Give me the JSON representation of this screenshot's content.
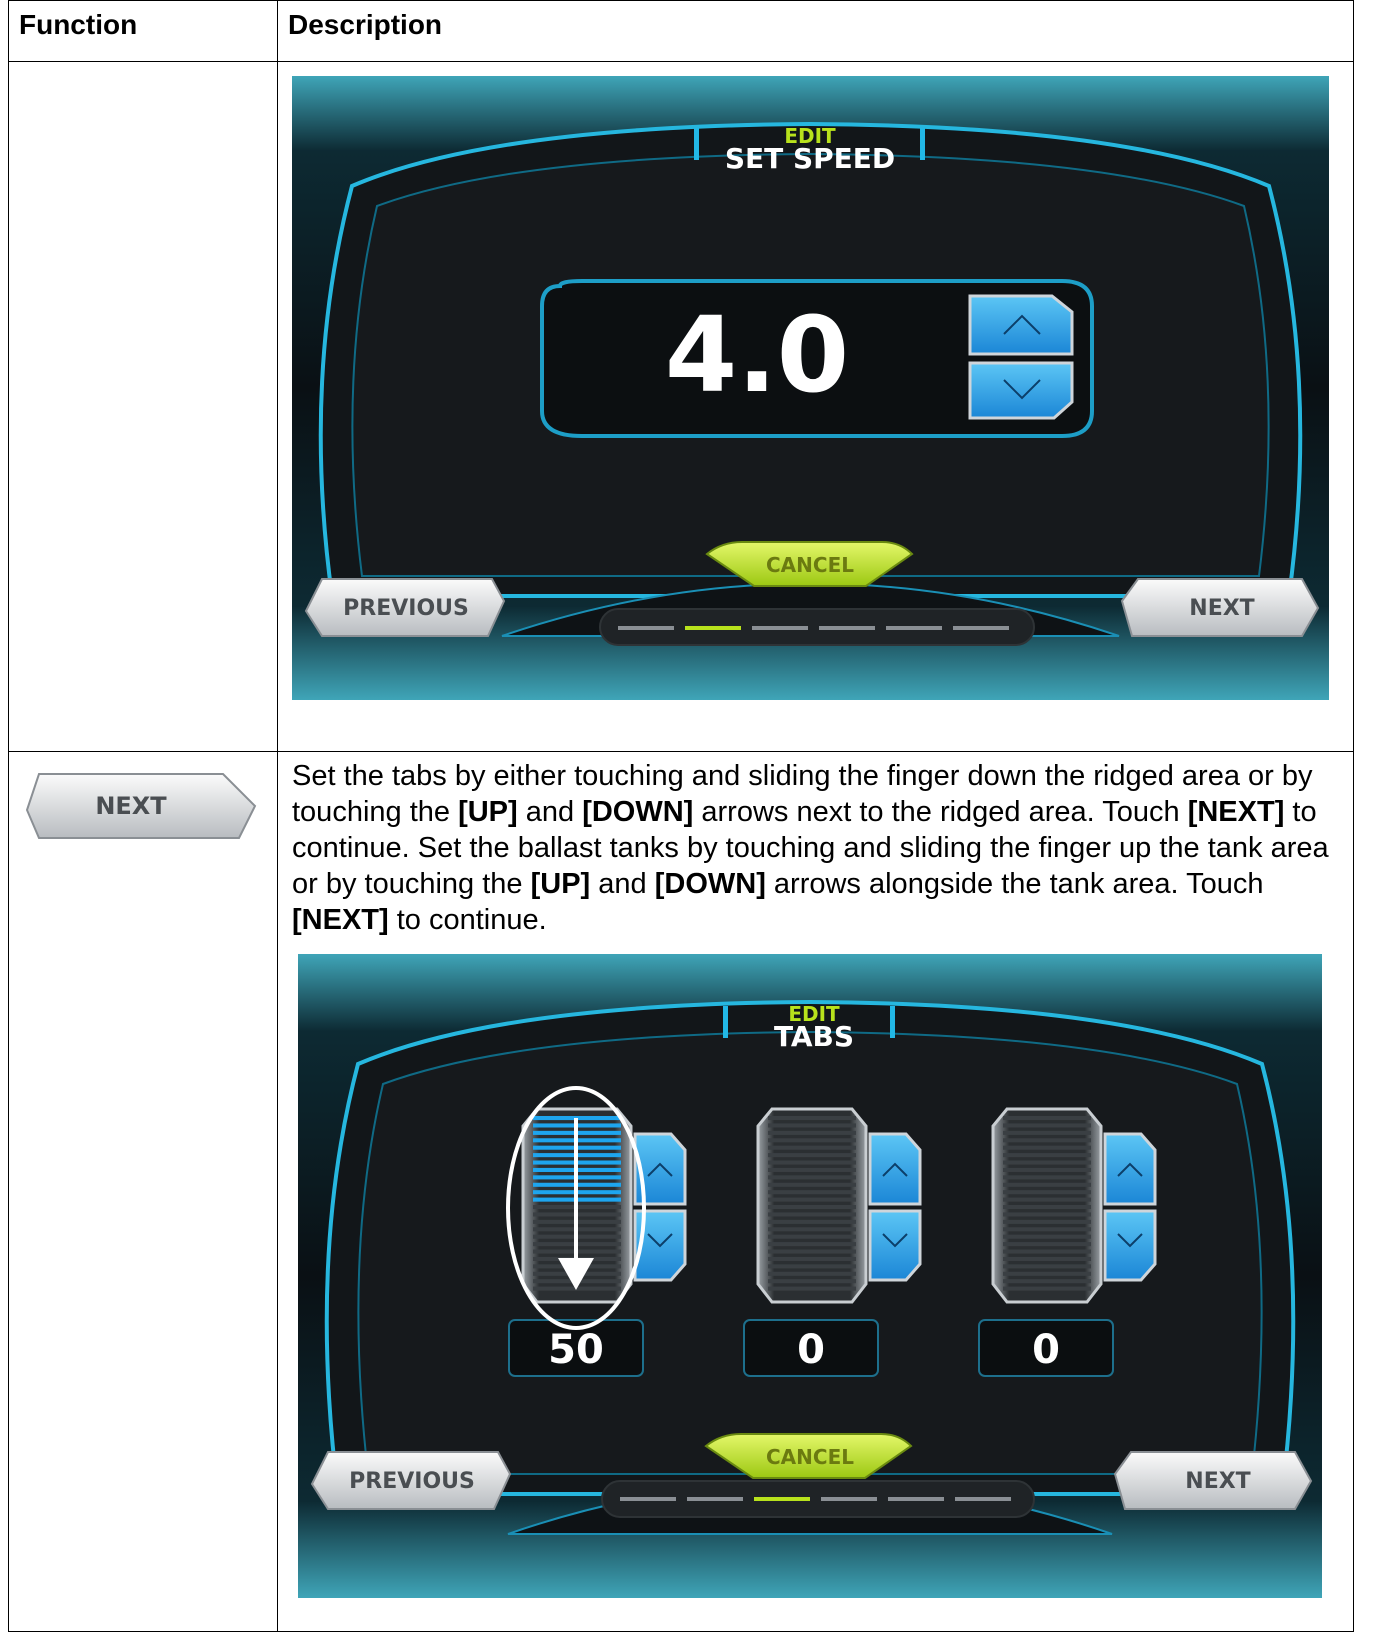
{
  "table": {
    "header": {
      "function": "Function",
      "description": "Description"
    }
  },
  "screen1": {
    "edit_label": "EDIT",
    "title": "SET SPEED",
    "speed_value": "4.0",
    "cancel_label": "CANCEL",
    "previous_label": "PREVIOUS",
    "next_label": "NEXT",
    "progress_steps": 6,
    "progress_active_step": 2
  },
  "row2": {
    "function_button_label": "NEXT",
    "description": {
      "s1": "Set the tabs by either touching and sliding the finger down the ridged area or by touching the ",
      "k1": "[UP]",
      "s2": " and ",
      "k2": "[DOWN]",
      "s3": " arrows next to the ridged area. Touch ",
      "k3": "[NEXT]",
      "s4": " to continue. Set the ballast tanks by touching and sliding the finger up the tank area or by touching the ",
      "k4": "[UP]",
      "s5": " and ",
      "k5": "[DOWN]",
      "s6": " arrows alongside the tank area. Touch ",
      "k6": "[NEXT]",
      "s7": " to continue."
    }
  },
  "screen2": {
    "edit_label": "EDIT",
    "title": "TABS",
    "tab_values": [
      "50",
      "0",
      "0"
    ],
    "tab_levels": [
      0.5,
      0,
      0
    ],
    "cancel_label": "CANCEL",
    "previous_label": "PREVIOUS",
    "next_label": "NEXT",
    "progress_steps": 6,
    "progress_active_step": 3
  },
  "colors": {
    "accent_blue": "#1e9be0",
    "accent_cyan": "#22b8e6",
    "accent_green": "#b8e21c",
    "button_silver": "#e4e6e8",
    "panel_dark": "#111518"
  }
}
